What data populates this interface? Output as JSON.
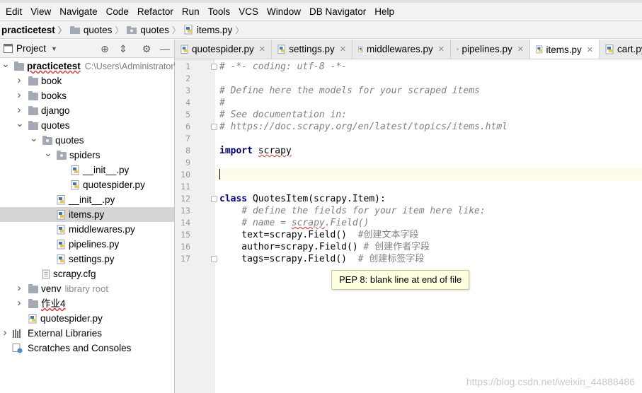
{
  "menu": [
    "Edit",
    "View",
    "Navigate",
    "Code",
    "Refactor",
    "Run",
    "Tools",
    "VCS",
    "Window",
    "DB Navigator",
    "Help"
  ],
  "breadcrumb": [
    "practicetest",
    "quotes",
    "quotes",
    "items.py"
  ],
  "project_panel": {
    "title": "Project",
    "icons": [
      "target-icon",
      "collapse-icon",
      "gear-icon",
      "minimize-icon"
    ]
  },
  "tree": [
    {
      "label": "practicetest",
      "sub": "C:\\Users\\Administrator\\",
      "kind": "root"
    },
    {
      "label": "book",
      "kind": "folder"
    },
    {
      "label": "books",
      "kind": "folder"
    },
    {
      "label": "django",
      "kind": "folder"
    },
    {
      "label": "quotes",
      "kind": "folder"
    },
    {
      "label": "quotes",
      "kind": "package"
    },
    {
      "label": "spiders",
      "kind": "package"
    },
    {
      "label": "__init__.py",
      "kind": "py"
    },
    {
      "label": "quotespider.py",
      "kind": "py"
    },
    {
      "label": "__init__.py",
      "kind": "py"
    },
    {
      "label": "items.py",
      "kind": "py",
      "selected": true
    },
    {
      "label": "middlewares.py",
      "kind": "py"
    },
    {
      "label": "pipelines.py",
      "kind": "py"
    },
    {
      "label": "settings.py",
      "kind": "py"
    },
    {
      "label": "scrapy.cfg",
      "kind": "cfg"
    },
    {
      "label": "venv",
      "sub": "library root",
      "kind": "folder"
    },
    {
      "label": "作业4",
      "kind": "folder"
    },
    {
      "label": "quotespider.py",
      "kind": "py"
    },
    {
      "label": "External Libraries",
      "kind": "lib"
    },
    {
      "label": "Scratches and Consoles",
      "kind": "scratch"
    }
  ],
  "tabs": [
    {
      "label": "quotespider.py"
    },
    {
      "label": "settings.py"
    },
    {
      "label": "middlewares.py"
    },
    {
      "label": "pipelines.py"
    },
    {
      "label": "items.py",
      "active": true
    },
    {
      "label": "cart.py"
    }
  ],
  "code_lines": [
    "# -*- coding: utf-8 -*-",
    "",
    "# Define here the models for your scraped items",
    "#",
    "# See documentation in:",
    "# https://doc.scrapy.org/en/latest/topics/items.html",
    "",
    "import scrapy",
    "",
    "",
    "",
    "class QuotesItem(scrapy.Item):",
    "    # define the fields for your item here like:",
    "    # name = scrapy.Field()",
    "    text=scrapy.Field()  #创建文本字段",
    "    author=scrapy.Field() # 创建作者字段",
    "    tags=scrapy.Field()  # 创建标签字段"
  ],
  "line_numbers": [
    "1",
    "2",
    "3",
    "4",
    "5",
    "6",
    "7",
    "8",
    "9",
    "10",
    "11",
    "12",
    "13",
    "14",
    "15",
    "16",
    "17"
  ],
  "tooltip": "PEP 8: blank line at end of file",
  "watermark": "https://blog.csdn.net/weixin_44888486",
  "colors": {
    "keyword": "#000080",
    "comment": "#808080",
    "selection": "#d5d5d5",
    "caret_line": "#fdfce8",
    "tooltip_bg": "#ffffe1"
  }
}
